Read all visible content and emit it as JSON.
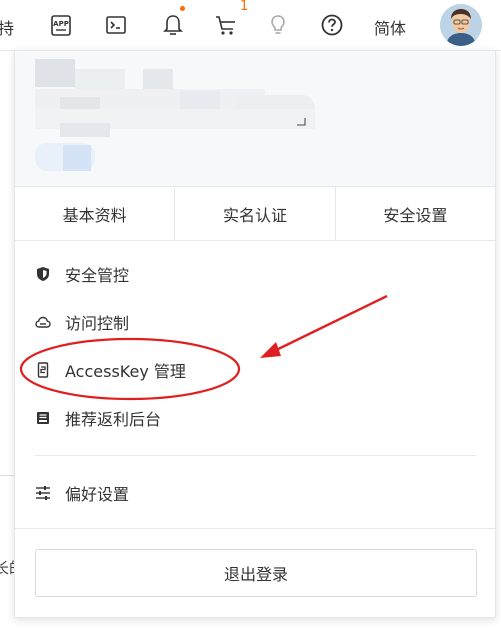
{
  "topbar": {
    "left_clip_text": "持",
    "icons": [
      "app-icon",
      "terminal-icon",
      "bell-icon",
      "cart-icon",
      "lightbulb-icon",
      "help-icon"
    ],
    "cart_count": "1",
    "language": "简体"
  },
  "background": {
    "clip_text": "长的"
  },
  "tabs": [
    {
      "label": "基本资料"
    },
    {
      "label": "实名认证"
    },
    {
      "label": "安全设置"
    }
  ],
  "menu": {
    "items": [
      {
        "label": "安全管控",
        "icon": "shield-icon"
      },
      {
        "label": "访问控制",
        "icon": "cloud-icon"
      },
      {
        "label": "AccessKey 管理",
        "icon": "key-icon"
      },
      {
        "label": "推荐返利后台",
        "icon": "inbox-icon"
      }
    ],
    "preferences": {
      "label": "偏好设置",
      "icon": "sliders-icon"
    },
    "logout_label": "退出登录"
  },
  "colors": {
    "accent": "#ff6a00",
    "annotation": "#e02020"
  }
}
